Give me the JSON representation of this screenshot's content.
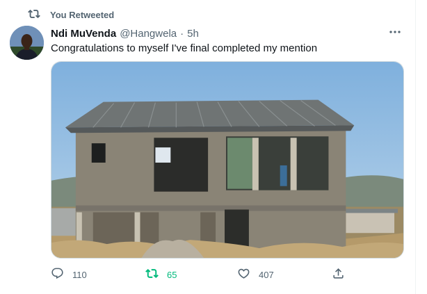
{
  "context": {
    "label": "You Retweeted",
    "icon": "retweet-icon"
  },
  "tweet": {
    "display_name": "Ndi MuVenda",
    "handle": "@Hangwela",
    "separator": "·",
    "time": "5h",
    "text": "Congratulations to myself I've final completed my mention",
    "media": {
      "description_icon": "house-photo"
    }
  },
  "actions": {
    "reply_count": "110",
    "retweet_count": "65",
    "like_count": "407"
  },
  "colors": {
    "retweet_active": "#00ba7c",
    "secondary_text": "#536471",
    "primary_text": "#0f1419"
  }
}
